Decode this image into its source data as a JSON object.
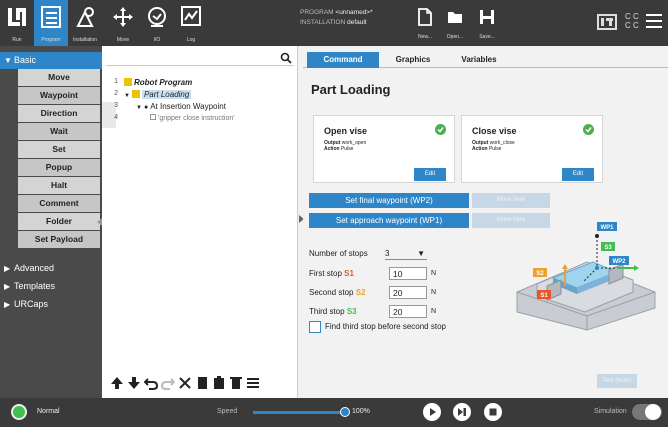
{
  "topbar": {
    "nav": [
      {
        "label": "Run",
        "icon": "ur-logo-icon"
      },
      {
        "label": "Program",
        "icon": "program-icon"
      },
      {
        "label": "Installation",
        "icon": "installation-icon"
      },
      {
        "label": "Move",
        "icon": "move-icon"
      },
      {
        "label": "I/O",
        "icon": "io-icon"
      },
      {
        "label": "Log",
        "icon": "log-icon"
      }
    ],
    "program_label": "PROGRAM",
    "program_value": "<unnamed>*",
    "installation_label": "INSTALLATION",
    "installation_value": "default",
    "file_buttons": [
      {
        "label": "New...",
        "icon": "new-file-icon"
      },
      {
        "label": "Open...",
        "icon": "folder-icon"
      },
      {
        "label": "Save...",
        "icon": "save-icon"
      }
    ],
    "cc_text": "C C\nC C"
  },
  "sidebar": {
    "basic_label": "Basic",
    "basic_items": [
      "Move",
      "Waypoint",
      "Direction",
      "Wait",
      "Set",
      "Popup",
      "Halt",
      "Comment",
      "Folder",
      "Set Payload"
    ],
    "other_categories": [
      "Advanced",
      "Templates",
      "URCaps"
    ]
  },
  "tree": {
    "line_numbers": [
      "1",
      "2",
      "3",
      "4"
    ],
    "rows": [
      {
        "text": "Robot Program"
      },
      {
        "text": "Part Loading"
      },
      {
        "text": "At Insertion Waypoint"
      },
      {
        "text": "'gripper close instruction'"
      }
    ]
  },
  "tabs": [
    "Command",
    "Graphics",
    "Variables"
  ],
  "panel": {
    "title": "Part Loading",
    "open_vise": {
      "title": "Open vise",
      "output_label": "Output",
      "output_value": "work_open",
      "action_label": "Action",
      "action_value": "Pulse",
      "edit_label": "Edit"
    },
    "close_vise": {
      "title": "Close vise",
      "output_label": "Output",
      "output_value": "work_close",
      "action_label": "Action",
      "action_value": "Pulse",
      "edit_label": "Edit"
    },
    "final_waypoint_label": "Set final waypoint (WP2)",
    "approach_waypoint_label": "Set approach waypoint (WP1)",
    "move_here_label": "Move here",
    "stops_label": "Number of stops",
    "stops_value": "3",
    "first_stop_label": "First stop",
    "first_stop_tag": "S1",
    "first_stop_value": "10",
    "second_stop_label": "Second stop",
    "second_stop_tag": "S2",
    "second_stop_value": "20",
    "third_stop_label": "Third stop",
    "third_stop_tag": "S3",
    "third_stop_value": "20",
    "unit": "N",
    "find_third_label": "Find third stop before second stop",
    "test_label": "Test (Hold)",
    "illus_labels": {
      "wp1": "WP1",
      "wp2": "WP2",
      "s1": "S1",
      "s2": "S2",
      "s3": "S3"
    }
  },
  "colors": {
    "accent": "#2e86c8",
    "s1": "#e8572a",
    "s2": "#f0a030",
    "s3": "#3fbf4f",
    "check": "#4caf50"
  },
  "bottombar": {
    "status": "Normal",
    "speed_label": "Speed",
    "speed_value": "100%",
    "speed_fraction": 1.0,
    "simulation_label": "Simulation"
  }
}
